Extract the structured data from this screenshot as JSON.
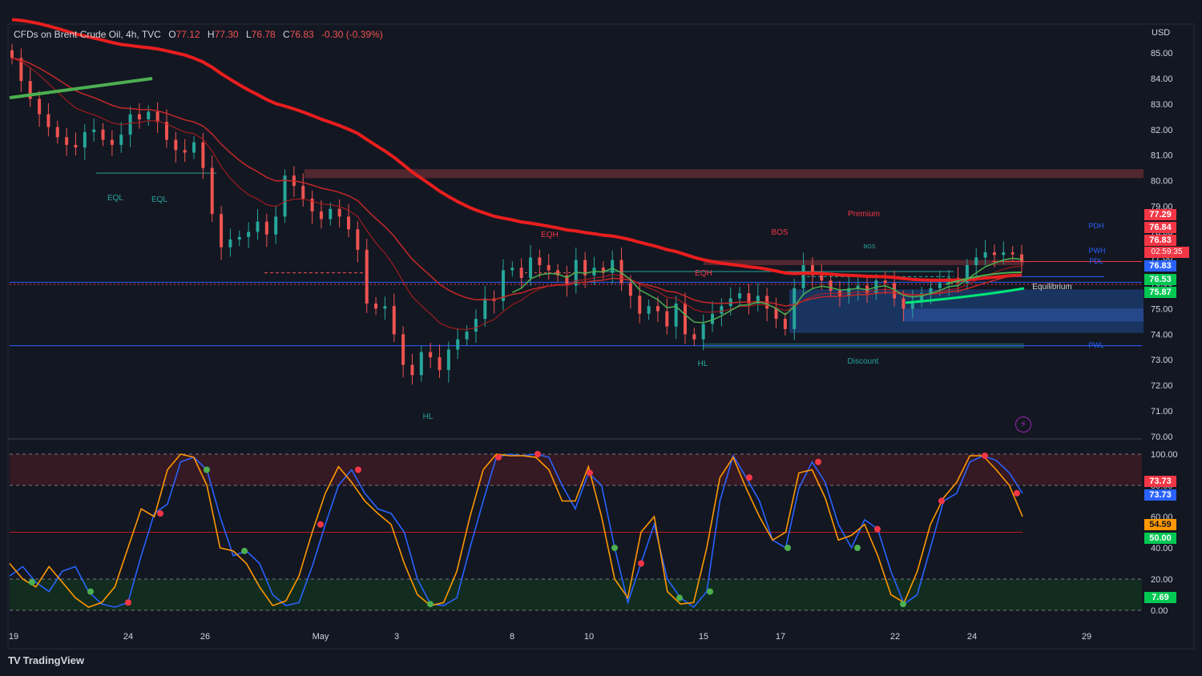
{
  "header": {
    "symbol": "CFDs on Brent Crude Oil, 4h, TVC",
    "open_label": "O",
    "open": "77.12",
    "high_label": "H",
    "high": "77.30",
    "low_label": "L",
    "low": "76.78",
    "close_label": "C",
    "close": "76.83",
    "change": "-0.30 (-0.39%)"
  },
  "currency": "USD",
  "brand": "TradingView",
  "countdown": "02:59:35",
  "colors": {
    "background": "#131722",
    "up": "#26a69a",
    "down": "#ef5350",
    "ema_red": "#e91e1e",
    "stoch_k": "#2962ff",
    "stoch_d": "#ff9800",
    "premium_zone": "#5d2a33",
    "discount_zone": "#1c3a6b"
  },
  "chart_data": [
    {
      "type": "candlestick",
      "pane": "price",
      "ylim": [
        70,
        85.5
      ],
      "yticks": [
        "85.00",
        "84.00",
        "83.00",
        "82.00",
        "81.00",
        "80.00",
        "79.00",
        "78.00",
        "77.00",
        "76.00",
        "75.00",
        "74.00",
        "73.00",
        "72.00",
        "71.00",
        "70.00"
      ],
      "xticks": [
        "19",
        "24",
        "26",
        "May",
        "3",
        "8",
        "10",
        "15",
        "17",
        "22",
        "24",
        "29"
      ],
      "price_close": [
        84.8,
        83.9,
        83.2,
        82.6,
        82.1,
        81.7,
        81.4,
        81.3,
        81.9,
        82.0,
        81.6,
        81.4,
        81.8,
        82.6,
        82.4,
        82.7,
        82.3,
        81.6,
        81.2,
        81.1,
        81.5,
        80.5,
        78.7,
        77.4,
        77.7,
        77.8,
        78.0,
        78.4,
        77.9,
        78.6,
        80.2,
        79.8,
        79.3,
        78.8,
        78.5,
        78.9,
        78.6,
        78.1,
        77.3,
        75.2,
        75.0,
        75.1,
        74.0,
        72.8,
        72.4,
        73.3,
        73.1,
        72.6,
        73.4,
        73.8,
        74.1,
        74.6,
        75.4,
        75.3,
        76.5,
        76.6,
        76.2,
        77.0,
        76.7,
        76.5,
        76.3,
        75.9,
        76.9,
        76.3,
        76.6,
        76.4,
        76.9,
        76.0,
        75.5,
        74.8,
        75.1,
        74.9,
        74.3,
        75.2,
        74.0,
        73.8,
        74.4,
        74.8,
        75.1,
        75.4,
        75.6,
        75.2,
        75.5,
        75.0,
        74.6,
        74.2,
        75.8,
        76.7,
        76.3,
        76.1,
        75.7,
        75.5,
        75.8,
        75.9,
        75.6,
        76.1,
        76.0,
        75.4,
        75.0,
        75.3,
        75.6,
        75.8,
        76.0,
        76.2,
        76.0,
        76.7,
        77.0,
        77.2,
        77.1,
        77.2,
        77.12,
        76.83
      ],
      "annotations": [
        "EQL",
        "EQL",
        "HL",
        "EQH",
        "EQH",
        "HL",
        "BOS",
        "BOS",
        "Premium",
        "Equilibrium",
        "Discount",
        "PDH",
        "PWH",
        "PDL",
        "PWL"
      ],
      "price_labels": [
        {
          "value": "77.29",
          "color": "#f23645"
        },
        {
          "value": "76.84",
          "color": "#f23645"
        },
        {
          "value": "76.83",
          "color": "#f23645"
        },
        {
          "value": "76.83",
          "color": "#2962ff"
        },
        {
          "value": "76.53",
          "color": "#00c853"
        },
        {
          "value": "75.87",
          "color": "#00c853"
        }
      ],
      "levels": {
        "pdh": 76.84,
        "pwh": 76.25,
        "pdl": 76.03,
        "pwl": 73.55,
        "equilibrium": 75.5
      }
    },
    {
      "type": "line",
      "pane": "stochastic",
      "ylim": [
        0,
        100
      ],
      "yticks": [
        "100.00",
        "80.00",
        "60.00",
        "40.00",
        "20.00",
        "0.00"
      ],
      "bands": {
        "overbought": 80,
        "oversold": 20,
        "mid": 50
      },
      "series": [
        {
          "color": "#2962ff",
          "values": [
            22,
            28,
            18,
            12,
            25,
            28,
            12,
            4,
            2,
            5,
            35,
            62,
            68,
            95,
            98,
            90,
            60,
            35,
            38,
            30,
            10,
            3,
            5,
            28,
            55,
            80,
            90,
            75,
            65,
            62,
            50,
            20,
            4,
            3,
            8,
            40,
            70,
            98,
            100,
            99,
            100,
            98,
            80,
            65,
            88,
            80,
            40,
            5,
            30,
            55,
            20,
            8,
            2,
            12,
            70,
            99,
            85,
            70,
            45,
            40,
            78,
            95,
            82,
            55,
            40,
            58,
            52,
            25,
            4,
            10,
            40,
            70,
            75,
            95,
            99,
            96,
            88,
            75
          ]
        },
        {
          "color": "#ff9800",
          "values": [
            30,
            20,
            15,
            28,
            18,
            8,
            2,
            5,
            15,
            40,
            65,
            60,
            90,
            100,
            98,
            80,
            40,
            38,
            30,
            15,
            3,
            6,
            22,
            50,
            75,
            92,
            82,
            70,
            62,
            55,
            30,
            10,
            3,
            5,
            25,
            60,
            90,
            100,
            99,
            99,
            98,
            90,
            70,
            70,
            92,
            60,
            20,
            8,
            50,
            60,
            12,
            4,
            5,
            40,
            85,
            98,
            78,
            60,
            45,
            50,
            88,
            90,
            72,
            45,
            48,
            55,
            35,
            10,
            5,
            25,
            55,
            72,
            82,
            99,
            99,
            90,
            80,
            60
          ]
        }
      ],
      "value_labels": [
        {
          "value": "73.73",
          "color": "#f23645"
        },
        {
          "value": "73.73",
          "color": "#2962ff"
        },
        {
          "value": "54.59",
          "color": "#ff9800"
        },
        {
          "value": "50.00",
          "color": "#00c853"
        },
        {
          "value": "7.69",
          "color": "#00c853"
        }
      ]
    }
  ]
}
